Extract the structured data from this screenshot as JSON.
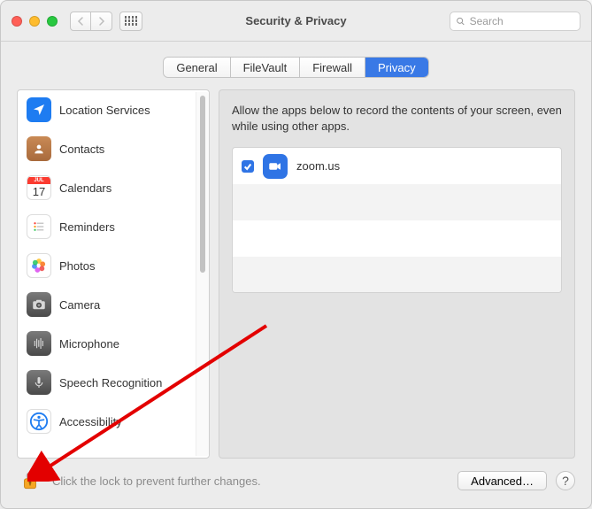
{
  "window_title": "Security & Privacy",
  "search": {
    "placeholder": "Search"
  },
  "tabs": {
    "general": "General",
    "filevault": "FileVault",
    "firewall": "Firewall",
    "privacy": "Privacy"
  },
  "sidebar": {
    "items": [
      {
        "label": "Location Services"
      },
      {
        "label": "Contacts"
      },
      {
        "label": "Calendars"
      },
      {
        "label": "Reminders"
      },
      {
        "label": "Photos"
      },
      {
        "label": "Camera"
      },
      {
        "label": "Microphone"
      },
      {
        "label": "Speech Recognition"
      },
      {
        "label": "Accessibility"
      }
    ]
  },
  "panel": {
    "description": "Allow the apps below to record the contents of your screen, even while using other apps.",
    "apps": [
      {
        "label": "zoom.us",
        "checked": true
      }
    ]
  },
  "footer": {
    "lock_text": "Click the lock to prevent further changes.",
    "advanced": "Advanced…",
    "help": "?"
  },
  "calendar_icon": {
    "month": "JUL",
    "day": "17"
  }
}
